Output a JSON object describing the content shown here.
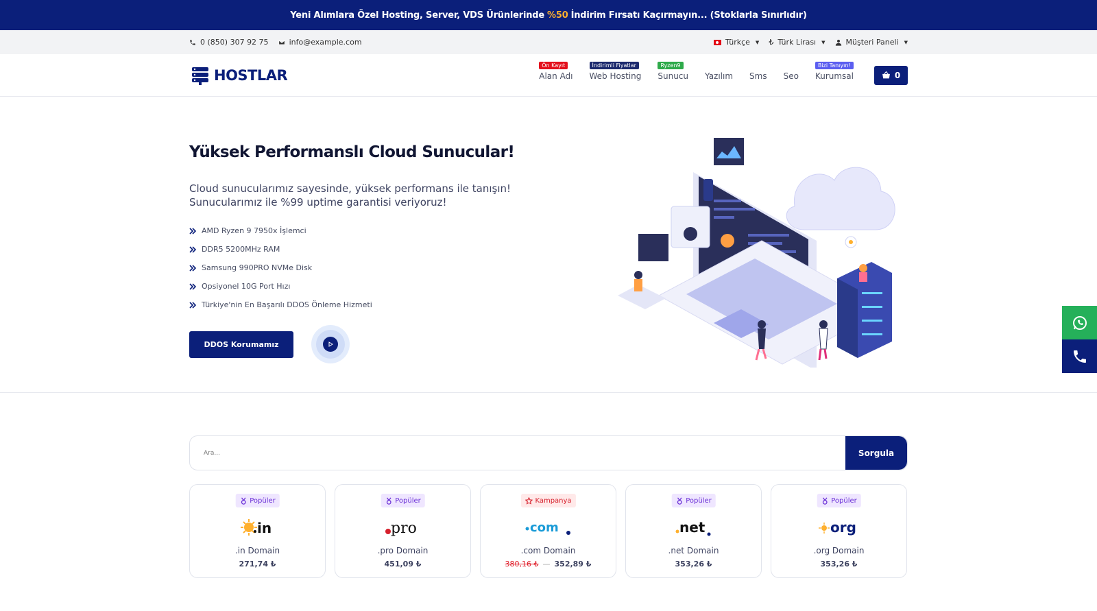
{
  "promo": {
    "text_before": "Yeni Alımlara Özel Hosting, Server, VDS Ürünlerinde",
    "highlight": "%50",
    "text_after": "İndirim Fırsatı Kaçırmayın... (Stoklarla Sınırlıdır)"
  },
  "topbar": {
    "phone": "0 (850) 307 92 75",
    "email": "info@example.com",
    "language": "Türkçe",
    "currency": "Türk Lirası",
    "account": "Müşteri Paneli"
  },
  "nav": {
    "logo": "HOSTLAR",
    "items": [
      {
        "label": "Alan Adı",
        "badge": "Ön Kayıt",
        "badge_color": "#e3101c"
      },
      {
        "label": "Web Hosting",
        "badge": "İndirimli Fiyatlar",
        "badge_color": "#1c2a6e"
      },
      {
        "label": "Sunucu",
        "badge": "Ryzen9",
        "badge_color": "#2eaa4a"
      },
      {
        "label": "Yazılım",
        "badge": "",
        "badge_color": ""
      },
      {
        "label": "Sms",
        "badge": "",
        "badge_color": ""
      },
      {
        "label": "Seo",
        "badge": "",
        "badge_color": ""
      },
      {
        "label": "Kurumsal",
        "badge": "Bizi Tanıyın!",
        "badge_color": "#5b5ef0"
      }
    ],
    "cart_count": "0"
  },
  "hero": {
    "title": "Yüksek Performanslı Cloud Sunucular!",
    "lead_line1": "Cloud sunucularımız sayesinde, yüksek performans ile tanışın!",
    "lead_line2": "Sunucularımız ile %99 uptime garantisi veriyoruz!",
    "features": [
      "AMD Ryzen 9 7950x İşlemci",
      "DDR5 5200MHz RAM",
      "Samsung 990PRO NVMe Disk",
      "Opsiyonel 10G Port Hızı",
      "Türkiye'nin En Başarılı DDOS Önleme Hizmeti"
    ],
    "cta": "DDOS Korumamız"
  },
  "search": {
    "placeholder": "Ara...",
    "button": "Sorgula"
  },
  "domains": [
    {
      "tag": "Popüler",
      "tag_type": "pop",
      "ext": ".in",
      "name": ".in Domain",
      "price": "271,74 ₺",
      "old_price": ""
    },
    {
      "tag": "Popüler",
      "tag_type": "pop",
      "ext": ".pro",
      "name": ".pro Domain",
      "price": "451,09 ₺",
      "old_price": ""
    },
    {
      "tag": "Kampanya",
      "tag_type": "camp",
      "ext": ".com",
      "name": ".com Domain",
      "price": "352,89 ₺",
      "old_price": "380,16 ₺"
    },
    {
      "tag": "Popüler",
      "tag_type": "pop",
      "ext": ".net",
      "name": ".net Domain",
      "price": "353,26 ₺",
      "old_price": ""
    },
    {
      "tag": "Popüler",
      "tag_type": "pop",
      "ext": ".org",
      "name": ".org Domain",
      "price": "353,26 ₺",
      "old_price": ""
    }
  ],
  "colors": {
    "primary": "#0b1f7a",
    "accent": "#ffb02e",
    "whatsapp": "#25b05a"
  }
}
